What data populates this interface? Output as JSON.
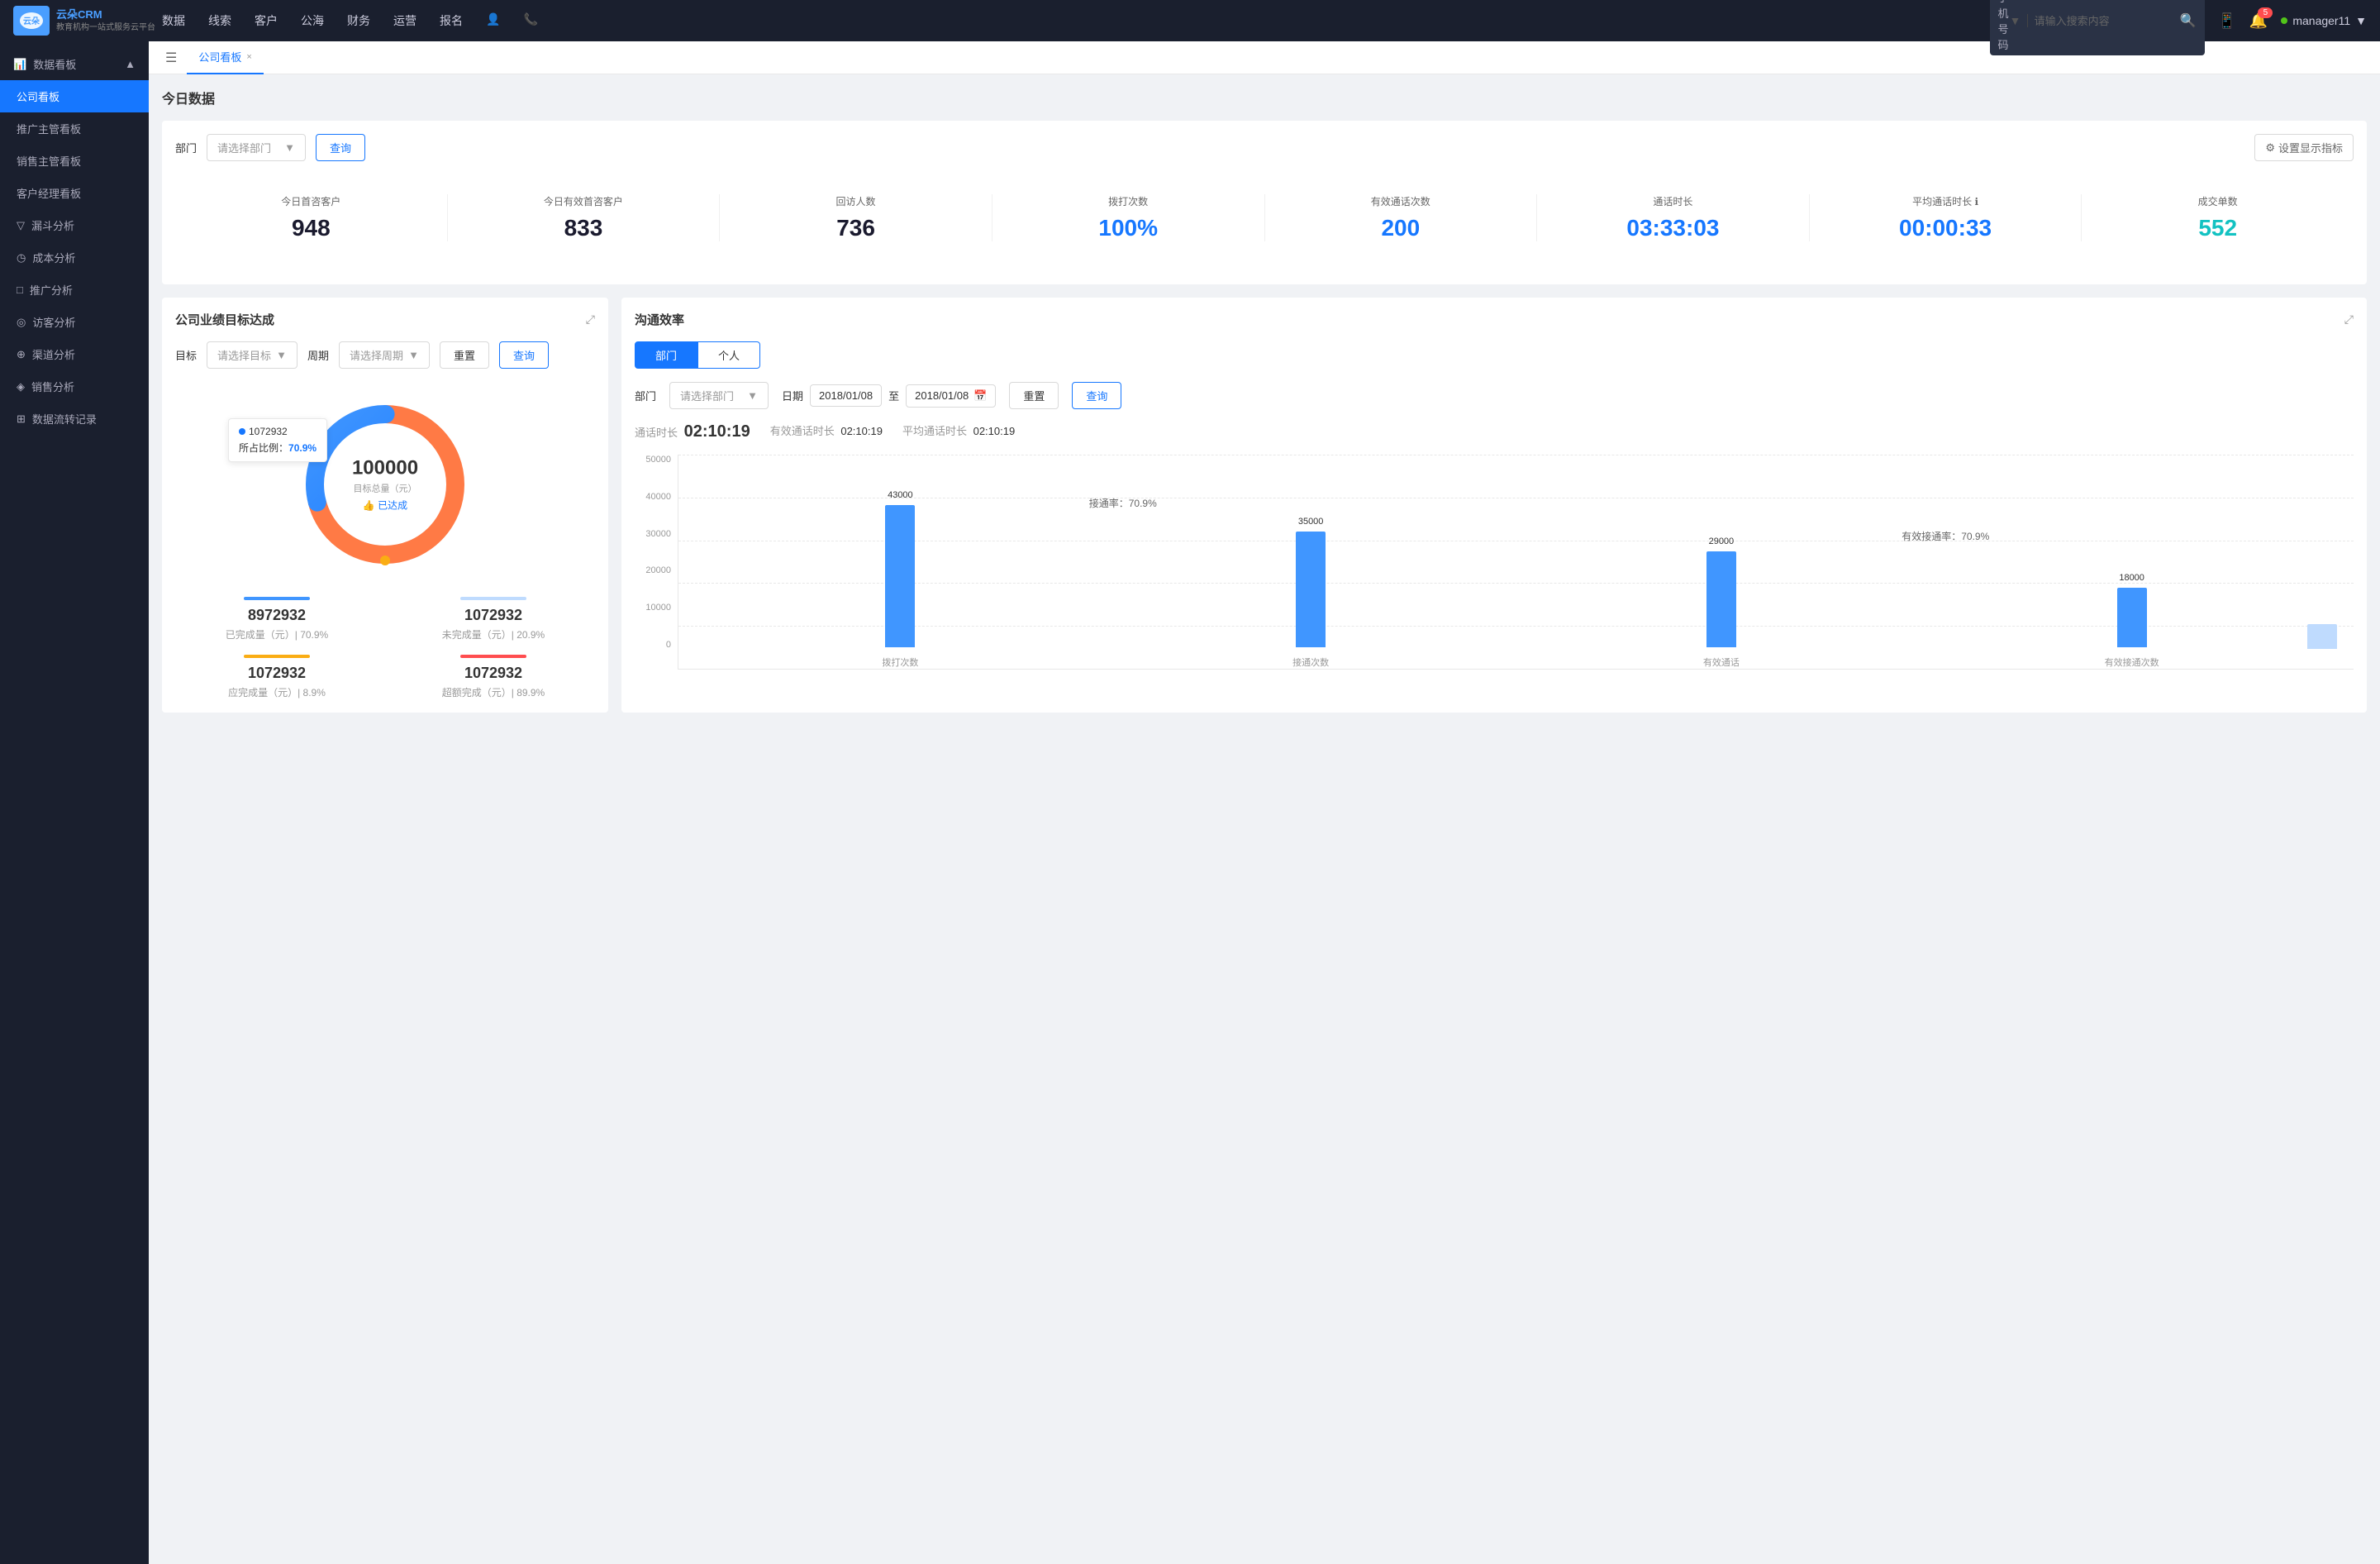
{
  "topNav": {
    "logoText1": "云朵CRM",
    "logoText2": "教育机构一站\n式服务云平台",
    "navItems": [
      "数据",
      "线索",
      "客户",
      "公海",
      "财务",
      "运营",
      "报名"
    ],
    "searchPlaceholder": "请输入搜索内容",
    "searchType": "手机号码",
    "notificationCount": "5",
    "username": "manager11"
  },
  "sidebar": {
    "sectionTitle": "数据看板",
    "items": [
      {
        "label": "公司看板",
        "active": true
      },
      {
        "label": "推广主管看板",
        "active": false
      },
      {
        "label": "销售主管看板",
        "active": false
      },
      {
        "label": "客户经理看板",
        "active": false
      },
      {
        "label": "漏斗分析",
        "active": false
      },
      {
        "label": "成本分析",
        "active": false
      },
      {
        "label": "推广分析",
        "active": false
      },
      {
        "label": "访客分析",
        "active": false
      },
      {
        "label": "渠道分析",
        "active": false
      },
      {
        "label": "销售分析",
        "active": false
      },
      {
        "label": "数据流转记录",
        "active": false
      }
    ]
  },
  "tab": {
    "label": "公司看板",
    "closeIcon": "×"
  },
  "todayData": {
    "title": "今日数据",
    "filterLabel": "部门",
    "filterPlaceholder": "请选择部门",
    "queryBtn": "查询",
    "settingsBtn": "设置显示指标",
    "stats": [
      {
        "label": "今日首咨客户",
        "value": "948",
        "color": "black"
      },
      {
        "label": "今日有效首咨客户",
        "value": "833",
        "color": "black"
      },
      {
        "label": "回访人数",
        "value": "736",
        "color": "black"
      },
      {
        "label": "拨打次数",
        "value": "100%",
        "color": "blue"
      },
      {
        "label": "有效通话次数",
        "value": "200",
        "color": "blue"
      },
      {
        "label": "通话时长",
        "value": "03:33:03",
        "color": "blue"
      },
      {
        "label": "平均通话时长",
        "value": "00:00:33",
        "color": "blue"
      },
      {
        "label": "成交单数",
        "value": "552",
        "color": "cyan"
      }
    ]
  },
  "goalPanel": {
    "title": "公司业绩目标达成",
    "goalLabel": "目标",
    "goalPlaceholder": "请选择目标",
    "periodLabel": "周期",
    "periodPlaceholder": "请选择周期",
    "resetBtn": "重置",
    "queryBtn": "查询",
    "donut": {
      "value": "100000",
      "subtitle": "目标总量（元）",
      "badge": "👍 已达成",
      "tooltipValue": "1072932",
      "tooltipPct": "70.9%",
      "tooltipLabel": "所占比例："
    },
    "statsGrid": [
      {
        "value": "8972932",
        "label": "已完成量（元）| 70.9%",
        "barColor": "#4096ff",
        "barWidth": "80px"
      },
      {
        "value": "1072932",
        "label": "未完成量（元）| 20.9%",
        "barColor": "#bfdbfe",
        "barWidth": "80px"
      },
      {
        "value": "1072932",
        "label": "应完成量（元）| 8.9%",
        "barColor": "#faad14",
        "barWidth": "80px"
      },
      {
        "value": "1072932",
        "label": "超额完成（元）| 89.9%",
        "barColor": "#ff4d4f",
        "barWidth": "80px"
      }
    ]
  },
  "commPanel": {
    "title": "沟通效率",
    "tabs": [
      "部门",
      "个人"
    ],
    "activeTab": 0,
    "filterLabel": "部门",
    "filterPlaceholder": "请选择部门",
    "dateLabel": "日期",
    "dateStart": "2018/01/08",
    "dateTo": "至",
    "dateEnd": "2018/01/08",
    "resetBtn": "重置",
    "queryBtn": "查询",
    "stats": {
      "callDurationLabel": "通话时长",
      "callDurationValue": "02:10:19",
      "effectiveLabel": "有效通话时长",
      "effectiveValue": "02:10:19",
      "avgLabel": "平均通话时长",
      "avgValue": "02:10:19"
    },
    "chart": {
      "yLabels": [
        "50000",
        "40000",
        "30000",
        "20000",
        "10000",
        "0"
      ],
      "groups": [
        {
          "label": "拨打次数",
          "value1": 43000,
          "value2": null,
          "rate": null
        },
        {
          "label": "接通次数",
          "value1": 35000,
          "value2": null,
          "rate": "接通率：70.9%"
        },
        {
          "label": "有效通话",
          "value1": 29000,
          "value2": null,
          "rate": null
        },
        {
          "label": "有效接通次数",
          "value1": 18000,
          "value2": null,
          "rate": "有效接通率：70.9%"
        }
      ],
      "maxValue": 50000
    }
  }
}
